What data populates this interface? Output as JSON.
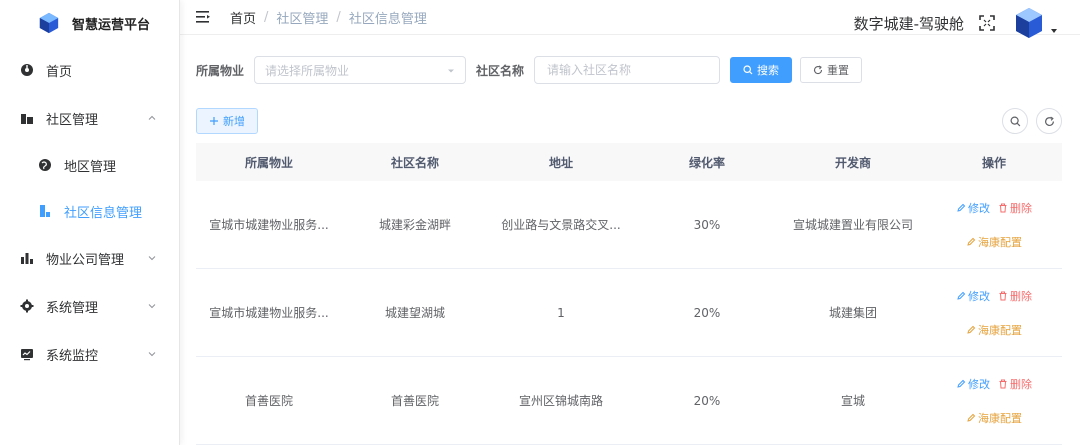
{
  "app": {
    "title": "智慧运营平台"
  },
  "sidebar": {
    "items": [
      {
        "label": "首页"
      },
      {
        "label": "社区管理",
        "children": [
          {
            "label": "地区管理"
          },
          {
            "label": "社区信息管理"
          }
        ]
      },
      {
        "label": "物业公司管理"
      },
      {
        "label": "系统管理"
      },
      {
        "label": "系统监控"
      }
    ]
  },
  "navbar": {
    "breadcrumb": [
      "首页",
      "社区管理",
      "社区信息管理"
    ],
    "title": "数字城建-驾驶舱"
  },
  "search": {
    "property_label": "所属物业",
    "property_placeholder": "请选择所属物业",
    "community_label": "社区名称",
    "community_placeholder": "请输入社区名称",
    "search_button": "搜索",
    "reset_button": "重置"
  },
  "toolbar": {
    "add_button": "新增"
  },
  "table": {
    "headers": [
      "所属物业",
      "社区名称",
      "地址",
      "绿化率",
      "开发商",
      "操作"
    ],
    "rows": [
      {
        "property": "宣城市城建物业服务...",
        "community": "城建彩金湖畔",
        "address": "创业路与文景路交叉...",
        "green_rate": "30%",
        "developer": "宣城城建置业有限公司"
      },
      {
        "property": "宣城市城建物业服务...",
        "community": "城建望湖城",
        "address": "1",
        "green_rate": "20%",
        "developer": "城建集团"
      },
      {
        "property": "首善医院",
        "community": "首善医院",
        "address": "宣州区锦城南路",
        "green_rate": "20%",
        "developer": "宣城"
      }
    ],
    "actions": {
      "edit": "修改",
      "delete": "删除",
      "config": "海康配置"
    }
  },
  "colors": {
    "primary": "#409eff",
    "danger": "#f56c6c",
    "warning": "#e6a23c"
  }
}
